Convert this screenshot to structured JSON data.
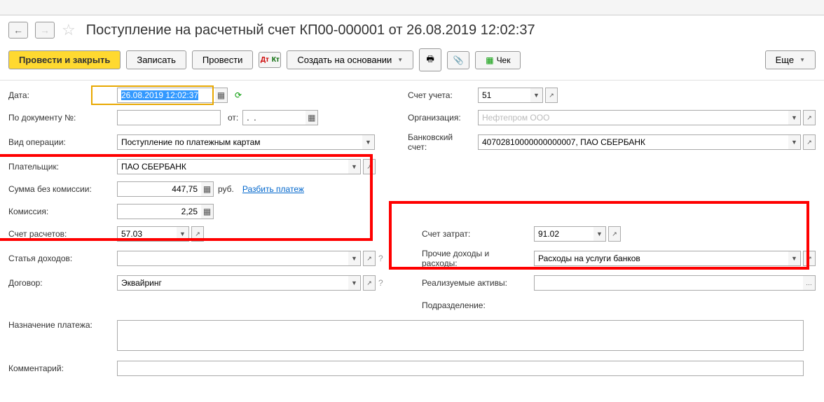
{
  "header": {
    "title": "Поступление на расчетный счет КП00-000001 от 26.08.2019 12:02:37"
  },
  "toolbar": {
    "post_and_close": "Провести и закрыть",
    "save": "Записать",
    "post": "Провести",
    "create_based": "Создать на основании",
    "check": "Чек",
    "more": "Еще"
  },
  "form": {
    "date_label": "Дата:",
    "date_value": "26.08.2019 12:02:37",
    "account_label": "Счет учета:",
    "account_value": "51",
    "doc_num_label": "По документу №:",
    "doc_num_value": "",
    "doc_from_label": "от:",
    "doc_from_value": ".  .",
    "org_label": "Организация:",
    "org_value": "Нефтепром ООО",
    "op_type_label": "Вид операции:",
    "op_type_value": "Поступление по платежным картам",
    "bank_account_label": "Банковский счет:",
    "bank_account_value": "40702810000000000007, ПАО СБЕРБАНК",
    "payer_label": "Плательщик:",
    "payer_value": "ПАО СБЕРБАНК",
    "sum_no_comm_label": "Сумма без комиссии:",
    "sum_no_comm_value": "447,75",
    "sum_unit": "руб.",
    "split_payment": "Разбить платеж",
    "commission_label": "Комиссия:",
    "commission_value": "2,25",
    "settle_account_label": "Счет расчетов:",
    "settle_account_value": "57.03",
    "expense_account_label": "Счет затрат:",
    "expense_account_value": "91.02",
    "income_item_label": "Статья доходов:",
    "income_item_value": "",
    "other_income_label": "Прочие доходы и расходы:",
    "other_income_value": "Расходы на услуги банков",
    "contract_label": "Договор:",
    "contract_value": "Эквайринг",
    "sold_assets_label": "Реализуемые активы:",
    "sold_assets_value": "",
    "division_label": "Подразделение:",
    "division_value": "",
    "purpose_label": "Назначение платежа:",
    "purpose_value": "",
    "comment_label": "Комментарий:",
    "comment_value": ""
  }
}
